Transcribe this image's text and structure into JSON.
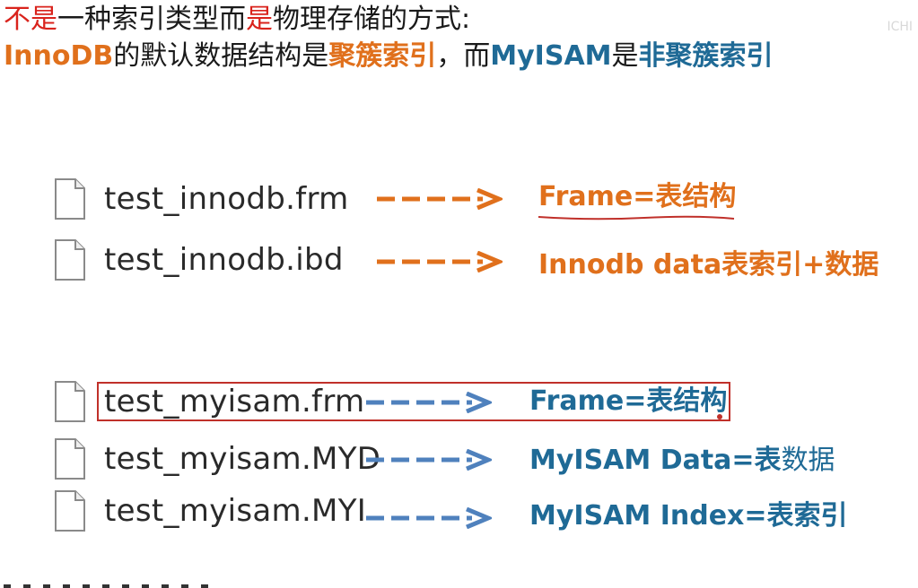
{
  "header": {
    "line1": {
      "p1": "不是",
      "p2": "一种索引类型而",
      "p3": "是",
      "p4": "物理存储的方式:"
    },
    "line2": {
      "p1": "InnoDB",
      "p2": "的默认数据结构是",
      "p3": "聚簇索引",
      "p4": "，而",
      "p5": "MyISAM",
      "p6": "是",
      "p7": "非聚簇索引"
    }
  },
  "innodb_files": [
    {
      "name": "test_innodb.frm",
      "desc": "Frame=表结构",
      "icon": "file-icon"
    },
    {
      "name": "test_innodb.ibd",
      "desc": "Innodb data表索引+数据",
      "icon": "file-icon"
    }
  ],
  "myisam_files": [
    {
      "name": "test_myisam.frm",
      "desc": "Frame=表结构",
      "icon": "file-icon"
    },
    {
      "name": "test_myisam.MYD",
      "desc_bold": "MyISAM Data=表",
      "desc_normal": "数据",
      "icon": "file-icon"
    },
    {
      "name": "test_myisam.MYI",
      "desc": "MyISAM Index=表索引",
      "icon": "file-icon"
    }
  ],
  "colors": {
    "red": "#d9231c",
    "orange": "#e0701c",
    "blue_text": "#1f6a96",
    "blue_arrow": "#4f81bd",
    "highlight_box": "#c0302a"
  },
  "ghost_label": "ICHI"
}
